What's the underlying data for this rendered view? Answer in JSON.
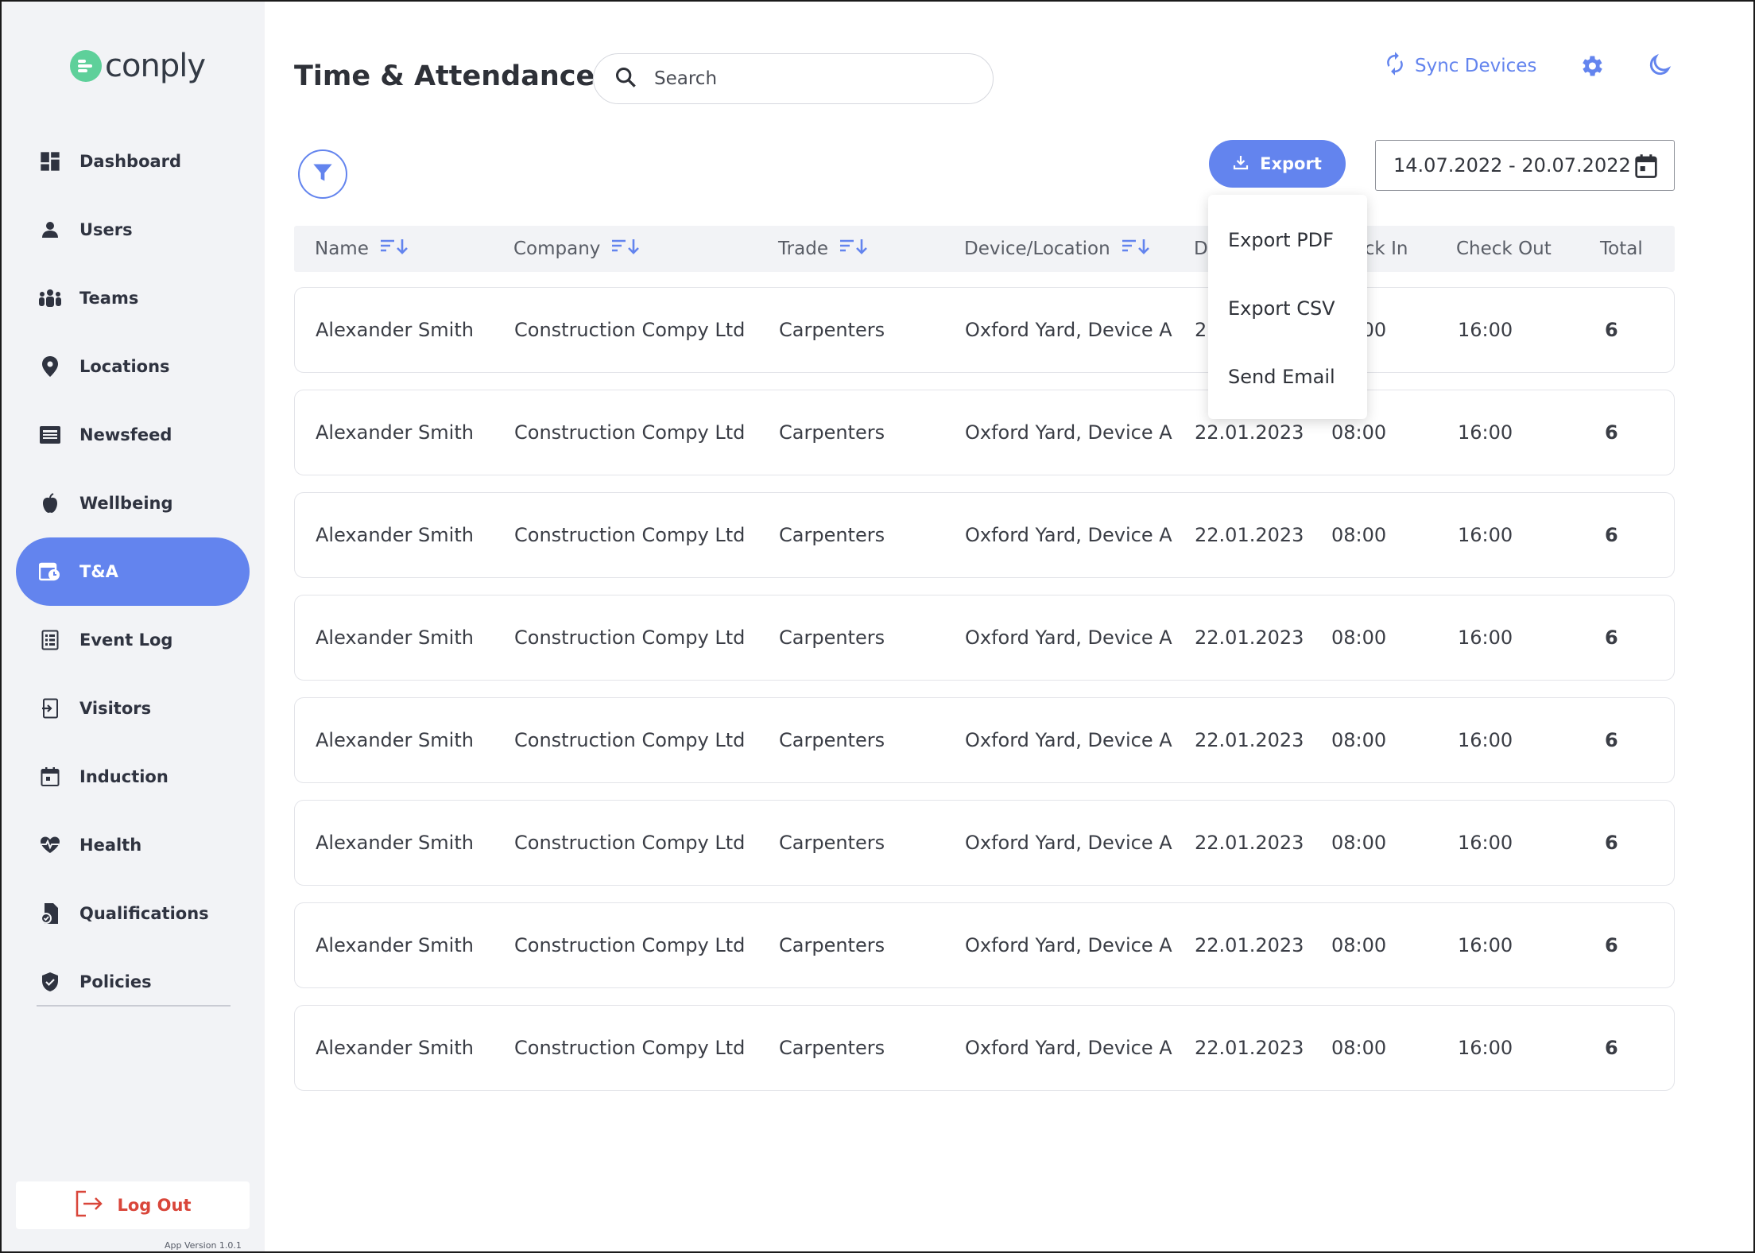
{
  "brand": {
    "name": "conply",
    "color": "#5ed09a"
  },
  "accent_color": "#6384ee",
  "sidebar": {
    "items": [
      {
        "id": "dashboard",
        "label": "Dashboard",
        "icon": "dashboard-icon"
      },
      {
        "id": "users",
        "label": "Users",
        "icon": "user-icon"
      },
      {
        "id": "teams",
        "label": "Teams",
        "icon": "teams-icon"
      },
      {
        "id": "locations",
        "label": "Locations",
        "icon": "location-pin-icon"
      },
      {
        "id": "newsfeed",
        "label": "Newsfeed",
        "icon": "newspaper-icon"
      },
      {
        "id": "wellbeing",
        "label": "Wellbeing",
        "icon": "apple-icon"
      },
      {
        "id": "ta",
        "label": "T&A",
        "icon": "time-attendance-icon"
      },
      {
        "id": "event-log",
        "label": "Event Log",
        "icon": "event-log-icon"
      },
      {
        "id": "visitors",
        "label": "Visitors",
        "icon": "sign-in-icon"
      },
      {
        "id": "induction",
        "label": "Induction",
        "icon": "calendar-icon"
      },
      {
        "id": "health",
        "label": "Health",
        "icon": "heart-pulse-icon"
      },
      {
        "id": "qualifications",
        "label": "Qualifications",
        "icon": "certificate-icon"
      },
      {
        "id": "policies",
        "label": "Policies",
        "icon": "shield-icon"
      }
    ],
    "active": "ta",
    "logout_label": "Log Out",
    "app_version": "App Version 1.0.1"
  },
  "header": {
    "title": "Time & Attendance",
    "search_placeholder": "Search",
    "sync_label": "Sync Devices"
  },
  "toolbar": {
    "export_label": "Export",
    "date_range": "14.07.2022 - 20.07.2022",
    "export_menu": [
      "Export PDF",
      "Export CSV",
      "Send Email"
    ]
  },
  "table": {
    "columns": [
      "Name",
      "Company",
      "Trade",
      "Device/Location",
      "Date",
      "Check In",
      "Check Out",
      "Total"
    ],
    "rows": [
      [
        "Alexander Smith",
        "Construction Compy Ltd",
        "Carpenters",
        "Oxford Yard, Device A",
        "22.01.2023",
        "08:00",
        "16:00",
        "6"
      ],
      [
        "Alexander Smith",
        "Construction Compy Ltd",
        "Carpenters",
        "Oxford Yard, Device A",
        "22.01.2023",
        "08:00",
        "16:00",
        "6"
      ],
      [
        "Alexander Smith",
        "Construction Compy Ltd",
        "Carpenters",
        "Oxford Yard, Device A",
        "22.01.2023",
        "08:00",
        "16:00",
        "6"
      ],
      [
        "Alexander Smith",
        "Construction Compy Ltd",
        "Carpenters",
        "Oxford Yard, Device A",
        "22.01.2023",
        "08:00",
        "16:00",
        "6"
      ],
      [
        "Alexander Smith",
        "Construction Compy Ltd",
        "Carpenters",
        "Oxford Yard, Device A",
        "22.01.2023",
        "08:00",
        "16:00",
        "6"
      ],
      [
        "Alexander Smith",
        "Construction Compy Ltd",
        "Carpenters",
        "Oxford Yard, Device A",
        "22.01.2023",
        "08:00",
        "16:00",
        "6"
      ],
      [
        "Alexander Smith",
        "Construction Compy Ltd",
        "Carpenters",
        "Oxford Yard, Device A",
        "22.01.2023",
        "08:00",
        "16:00",
        "6"
      ],
      [
        "Alexander Smith",
        "Construction Compy Ltd",
        "Carpenters",
        "Oxford Yard, Device A",
        "22.01.2023",
        "08:00",
        "16:00",
        "6"
      ]
    ]
  }
}
